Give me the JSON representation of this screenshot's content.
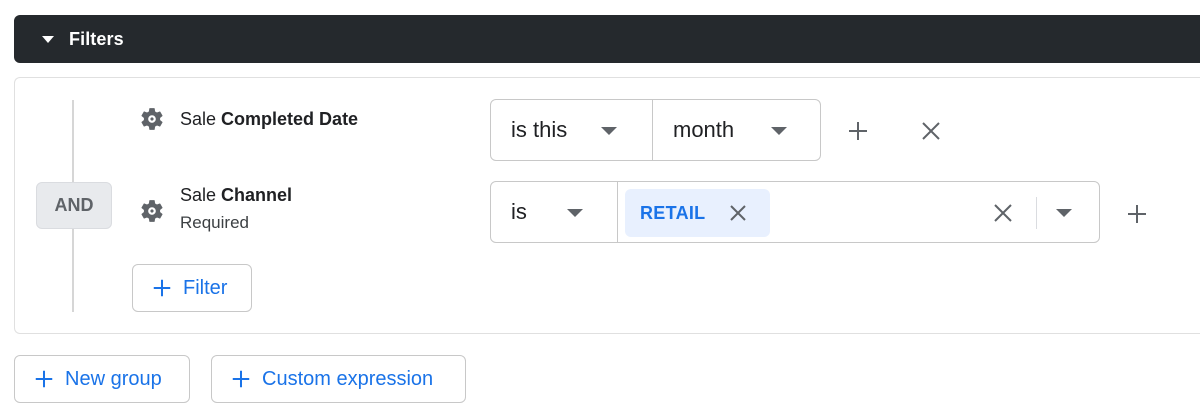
{
  "header": {
    "title": "Filters",
    "caret_icon": "caret-down-icon"
  },
  "group": {
    "operator": "AND",
    "filters": [
      {
        "field_prefix": "Sale",
        "field_name": "Completed Date",
        "operator": "is this",
        "unit": "month"
      },
      {
        "field_prefix": "Sale",
        "field_name": "Channel",
        "sublabel": "Required",
        "operator": "is",
        "chips": [
          "RETAIL"
        ]
      }
    ],
    "add_filter_label": "Filter"
  },
  "footer": {
    "new_group_label": "New group",
    "custom_expression_label": "Custom expression"
  },
  "colors": {
    "accent": "#1a73e8",
    "chip_bg": "#e8f0fe",
    "header_bg": "#25292d"
  }
}
